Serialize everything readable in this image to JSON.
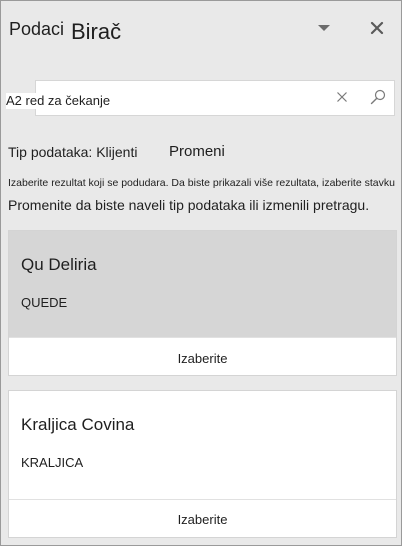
{
  "pane": {
    "title_part1": "Podaci",
    "title_part2": "Birač",
    "icons": {
      "dropdown": "chevron-down-icon",
      "close": "close-icon"
    }
  },
  "search": {
    "value": "A2 red za čekanje",
    "icons": {
      "clear": "clear-icon",
      "search": "search-icon"
    }
  },
  "data_type": {
    "label": "Tip podataka: Klijenti",
    "change_label": "Promeni"
  },
  "hints": {
    "small": "Izaberite rezultat koji se podudara. Da biste prikazali više rezultata, izaberite stavku",
    "large": "Promenite da biste naveli tip podataka ili izmenili pretragu."
  },
  "results": [
    {
      "name": "Qu Deliria",
      "code": "QUEDE",
      "select_label": "Izaberite",
      "selected": true
    },
    {
      "name": "Kraljica Covina",
      "code": "KRALJICA",
      "select_label": "Izaberite",
      "selected": false
    }
  ],
  "colors": {
    "pane_background": "#e9e9e9",
    "selected_card": "#d6d6d6",
    "card_background": "#ffffff"
  }
}
